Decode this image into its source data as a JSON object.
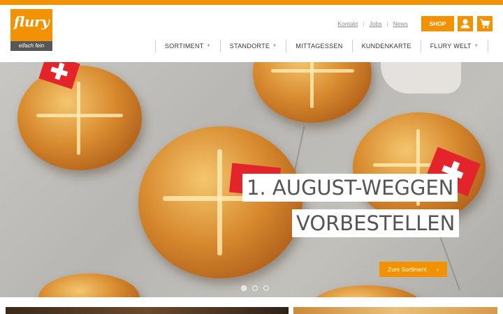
{
  "brand": {
    "logo_word": "flury",
    "tagline": "eifach fein",
    "accent": "#f39200",
    "dark": "#575757"
  },
  "utility_links": [
    "Kontakt",
    "Jobs",
    "News"
  ],
  "shop_button": "SHOP",
  "icons": {
    "account": "person-icon",
    "cart": "cart-icon"
  },
  "nav": [
    {
      "label": "SORTIMENT",
      "has_menu": true
    },
    {
      "label": "STANDORTE",
      "has_menu": true
    },
    {
      "label": "MITTAGESSEN",
      "has_menu": false
    },
    {
      "label": "KUNDENKARTE",
      "has_menu": false
    },
    {
      "label": "FLURY WELT",
      "has_menu": true
    }
  ],
  "hero": {
    "headline_1": "1. AUGUST-WEGGEN",
    "headline_2": "VORBESTELLEN",
    "cta_label": "Zum Sortiment",
    "slide_count": 3,
    "active_slide": 1
  }
}
